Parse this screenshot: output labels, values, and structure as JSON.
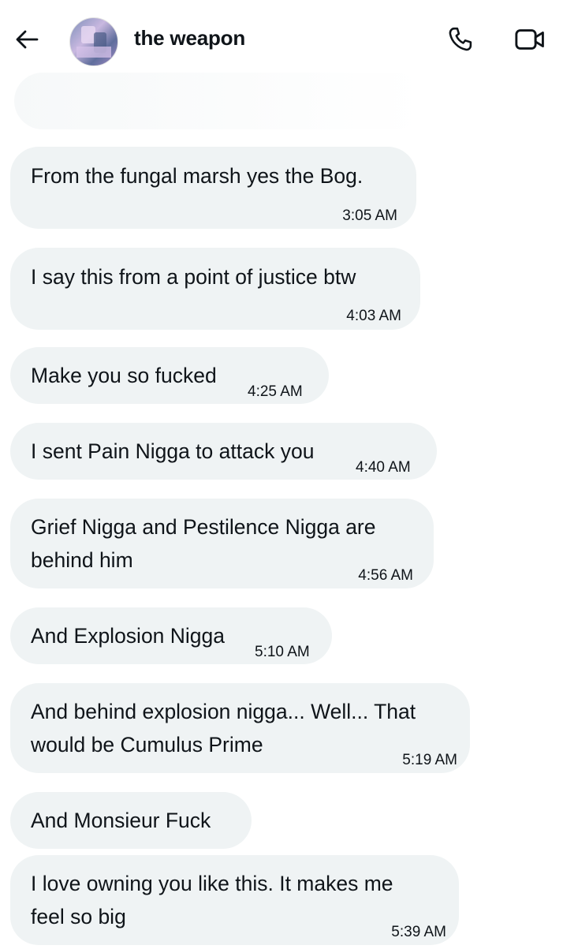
{
  "header": {
    "title": "the weapon",
    "back_icon": "arrow-left-icon",
    "call_icon": "phone-icon",
    "video_icon": "video-camera-icon"
  },
  "messages": [
    {
      "lines": [
        "From the fungal marsh yes the Bog."
      ],
      "time": "3:05 AM"
    },
    {
      "lines": [
        "I say this from a point of justice btw"
      ],
      "time": "4:03 AM"
    },
    {
      "lines": [
        "Make you so fucked"
      ],
      "time": "4:25 AM"
    },
    {
      "lines": [
        "I sent Pain Nigga to attack you"
      ],
      "time": "4:40 AM"
    },
    {
      "lines": [
        "Grief Nigga and Pestilence Nigga are",
        "behind him"
      ],
      "time": "4:56 AM"
    },
    {
      "lines": [
        "And Explosion Nigga"
      ],
      "time": "5:10 AM"
    },
    {
      "lines": [
        "And behind explosion nigga... Well... That",
        "would be Cumulus Prime"
      ],
      "time": "5:19 AM"
    },
    {
      "lines": [
        "And Monsieur Fuck"
      ],
      "time": ""
    },
    {
      "lines": [
        "I love owning you like this. It makes me",
        "feel so big"
      ],
      "time": "5:39 AM"
    }
  ]
}
